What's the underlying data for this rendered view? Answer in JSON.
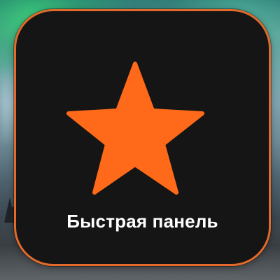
{
  "tile": {
    "label": "Быстрая панель",
    "icon": "star-icon",
    "accent_color": "#ff6a1a",
    "border_color": "#e36a2a",
    "background_color": "#151515"
  },
  "background": {
    "scene": "aurora-over-coast"
  }
}
